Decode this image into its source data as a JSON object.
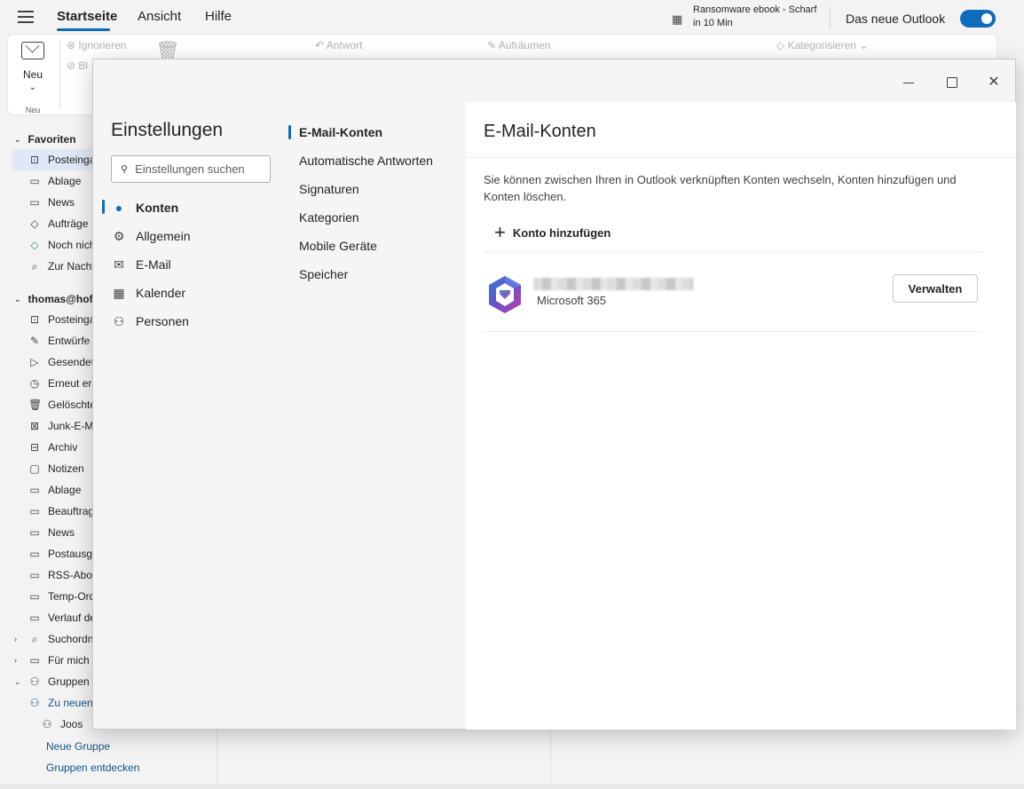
{
  "topbar": {
    "tabs": [
      "Startseite",
      "Ansicht",
      "Hilfe"
    ],
    "reminder_line1": "Ransomware ebook - Scharf",
    "reminder_line2": "in 10 Min",
    "new_outlook_label": "Das neue Outlook",
    "accent_color": "#0f6cbd"
  },
  "ribbon": {
    "new_label": "Neu",
    "group_label": "Neu",
    "dimmed": [
      "Ignorieren",
      "Bl",
      "Antwort",
      "Aufräumen",
      "Kategorisieren"
    ]
  },
  "folders": {
    "favorites_header": "Favoriten",
    "favorites": [
      {
        "label": "Posteinga",
        "icon": "inbox-icon"
      },
      {
        "label": "Ablage",
        "icon": "folder-icon"
      },
      {
        "label": "News",
        "icon": "folder-icon"
      },
      {
        "label": "Aufträge",
        "icon": "tag-icon"
      },
      {
        "label": "Noch nich",
        "icon": "tag-icon"
      },
      {
        "label": "Zur Nachv",
        "icon": "search-folder-icon"
      }
    ],
    "account_header": "thomas@hof-",
    "account_items": [
      {
        "label": "Posteinga",
        "icon": "inbox-icon"
      },
      {
        "label": "Entwürfe",
        "icon": "pencil-icon"
      },
      {
        "label": "Gesendete",
        "icon": "send-icon"
      },
      {
        "label": "Erneut erin",
        "icon": "clock-icon"
      },
      {
        "label": "Gelöschte",
        "icon": "trash-icon"
      },
      {
        "label": "Junk-E-Ma",
        "icon": "junk-icon"
      },
      {
        "label": "Archiv",
        "icon": "archive-icon"
      },
      {
        "label": "Notizen",
        "icon": "note-icon"
      },
      {
        "label": "Ablage",
        "icon": "folder-icon"
      },
      {
        "label": "Beauftrag",
        "icon": "folder-icon"
      },
      {
        "label": "News",
        "icon": "folder-icon"
      },
      {
        "label": "Postausga",
        "icon": "outbox-icon"
      },
      {
        "label": "RSS-Abon",
        "icon": "folder-icon"
      },
      {
        "label": "Temp-Ord",
        "icon": "folder-icon"
      },
      {
        "label": "Verlauf de",
        "icon": "folder-icon"
      },
      {
        "label": "Suchordne",
        "icon": "search-folder-icon"
      },
      {
        "label": "Für mich f",
        "icon": "folder-icon"
      },
      {
        "label": "Gruppen",
        "icon": "groups-icon"
      },
      {
        "label": "Zu neuen",
        "icon": "groups-icon"
      },
      {
        "label": "Joos",
        "icon": "groups-icon"
      }
    ],
    "new_group": "Neue Gruppe",
    "discover_groups": "Gruppen entdecken"
  },
  "settings": {
    "title": "Einstellungen",
    "search_placeholder": "Einstellungen suchen",
    "categories": [
      {
        "label": "Konten",
        "icon": "person-icon"
      },
      {
        "label": "Allgemein",
        "icon": "gear-icon"
      },
      {
        "label": "E-Mail",
        "icon": "mail-icon"
      },
      {
        "label": "Kalender",
        "icon": "calendar-icon"
      },
      {
        "label": "Personen",
        "icon": "people-icon"
      }
    ],
    "subcategories": [
      "E-Mail-Konten",
      "Automatische Antworten",
      "Signaturen",
      "Kategorien",
      "Mobile Geräte",
      "Speicher"
    ],
    "content": {
      "heading": "E-Mail-Konten",
      "description": "Sie können zwischen Ihren in Outlook verknüpften Konten wechseln, Konten hinzufügen und Konten löschen.",
      "add_account": "Konto hinzufügen",
      "account_type": "Microsoft 365",
      "manage_button": "Verwalten"
    }
  }
}
